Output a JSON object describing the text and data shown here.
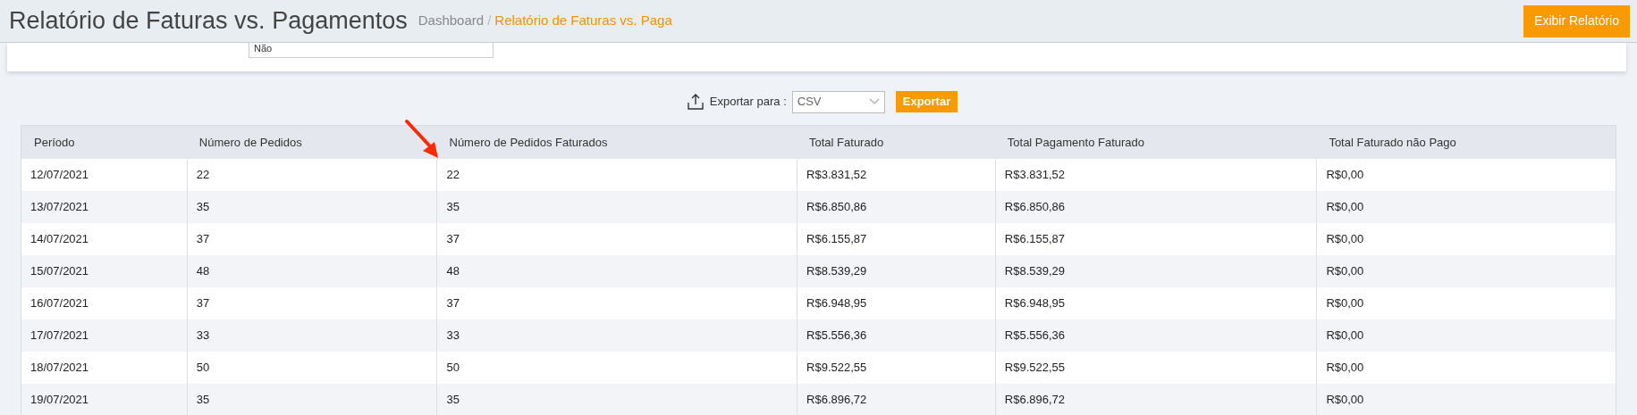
{
  "header": {
    "title": "Relatório de Faturas vs. Pagamentos",
    "breadcrumb_separator": "/",
    "breadcrumb": [
      {
        "label": "Dashboard",
        "selected": false
      },
      {
        "label": "Relatório de Faturas vs. Paga",
        "selected": true
      }
    ],
    "action_button": "Exibir Relatório"
  },
  "filter": {
    "value": "Não"
  },
  "export": {
    "label": "Exportar para :",
    "format": "CSV",
    "button": "Exportar"
  },
  "table": {
    "columns": [
      "Período",
      "Número de Pedidos",
      "Número de Pedidos Faturados",
      "Total Faturado",
      "Total Pagamento Faturado",
      "Total Faturado não Pago"
    ],
    "rows": [
      [
        "12/07/2021",
        "22",
        "22",
        "R$3.831,52",
        "R$3.831,52",
        "R$0,00"
      ],
      [
        "13/07/2021",
        "35",
        "35",
        "R$6.850,86",
        "R$6.850,86",
        "R$0,00"
      ],
      [
        "14/07/2021",
        "37",
        "37",
        "R$6.155,87",
        "R$6.155,87",
        "R$0,00"
      ],
      [
        "15/07/2021",
        "48",
        "48",
        "R$8.539,29",
        "R$8.539,29",
        "R$0,00"
      ],
      [
        "16/07/2021",
        "37",
        "37",
        "R$6.948,95",
        "R$6.948,95",
        "R$0,00"
      ],
      [
        "17/07/2021",
        "33",
        "33",
        "R$5.556,36",
        "R$5.556,36",
        "R$0,00"
      ],
      [
        "18/07/2021",
        "50",
        "50",
        "R$9.522,55",
        "R$9.522,55",
        "R$0,00"
      ],
      [
        "19/07/2021",
        "35",
        "35",
        "R$6.896,72",
        "R$6.896,72",
        "R$0,00"
      ]
    ]
  }
}
